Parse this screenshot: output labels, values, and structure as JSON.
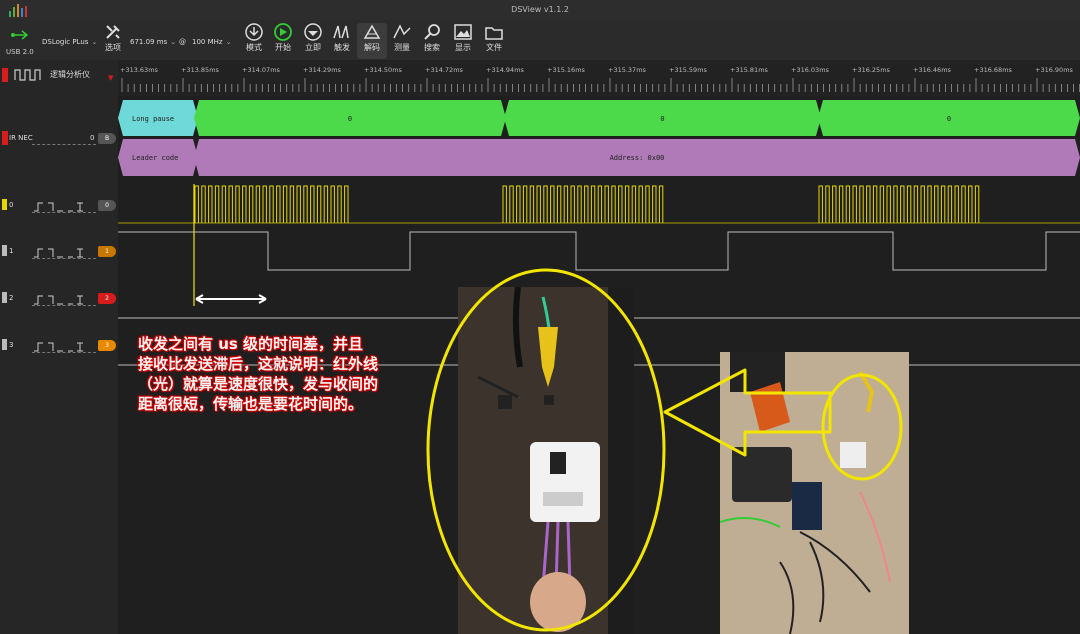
{
  "window": {
    "title": "DSView v1.1.2"
  },
  "device": {
    "name": "DSLogic PLus",
    "connection": "USB 2.0",
    "options_label": "选项"
  },
  "toolbar": {
    "sample_depth": "671.09 ms",
    "at_sign": "@",
    "sample_rate": "100 MHz",
    "mode_label": "模式",
    "start_label": "开始",
    "instant_label": "立即",
    "trigger_label": "触发",
    "decode_label": "解码",
    "measure_label": "测量",
    "search_label": "搜索",
    "display_label": "显示",
    "file_label": "文件"
  },
  "left_panel": {
    "analyzer_label": "逻辑分析仪"
  },
  "ruler": {
    "ticks": [
      "+313.63ms",
      "+313.85ms",
      "+314.07ms",
      "+314.29ms",
      "+314.50ms",
      "+314.72ms",
      "+314.94ms",
      "+315.16ms",
      "+315.37ms",
      "+315.59ms",
      "+315.81ms",
      "+316.03ms",
      "+316.25ms",
      "+316.46ms",
      "+316.68ms",
      "+316.90ms"
    ]
  },
  "decoder": {
    "name": "IR NEC",
    "channel_badge": "0",
    "badge_letter": "B",
    "row1": {
      "first": "Long pause",
      "segments": [
        "0",
        "0",
        "0"
      ]
    },
    "row2": {
      "first": "Leader code",
      "address": "Address: 0x00"
    }
  },
  "channels": [
    {
      "index": "0",
      "trigger_badge": "0",
      "color": "#e5d800"
    },
    {
      "index": "1",
      "trigger_badge": "1",
      "color": "#c87800"
    },
    {
      "index": "2",
      "trigger_badge": "2",
      "color": "#d81c1c"
    },
    {
      "index": "3",
      "trigger_badge": "3",
      "color": "#e88a00"
    }
  ],
  "annotation": {
    "text": "收发之间有 us 级的时间差，并且接收比发送滞后，这就说明：红外线（光）就算是速度很快，发与收间的距离很短，传输也是要花时间的。"
  },
  "colors": {
    "decode_green": "#4cd94a",
    "decode_cyan": "#6fd8d8",
    "decode_purple": "#b07ab8",
    "highlight_yellow": "#f2e600"
  }
}
